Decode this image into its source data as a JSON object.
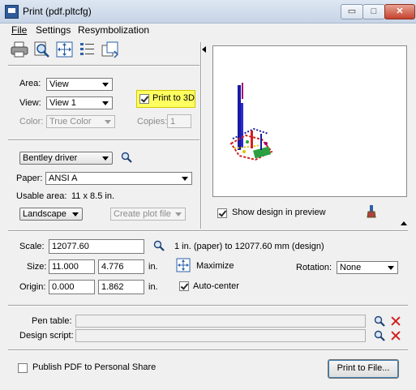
{
  "window": {
    "title": "Print  (pdf.pltcfg)",
    "min_glyph": "▭",
    "max_glyph": "□",
    "close_glyph": "✕"
  },
  "menu": {
    "file": "File",
    "settings": "Settings",
    "resymbolization": "Resymbolization"
  },
  "toolbar": [
    "printer-icon",
    "preview-zoom-icon",
    "fit-icon",
    "list-icon",
    "copy-icon"
  ],
  "area": {
    "label": "Area:",
    "value": "View"
  },
  "view": {
    "label": "View:",
    "value": "View 1"
  },
  "print_to_3d": {
    "label": "Print to 3D",
    "checked": true
  },
  "color": {
    "label": "Color:",
    "value": "True Color"
  },
  "copies": {
    "label": "Copies:",
    "value": "1"
  },
  "driver": {
    "value": "Bentley driver"
  },
  "paper": {
    "label": "Paper:",
    "value": "ANSI A"
  },
  "usable_area": {
    "label": "Usable area:",
    "value": "11 x 8.5 in."
  },
  "orientation": {
    "value": "Landscape"
  },
  "create_plot_file": {
    "value": "Create plot file"
  },
  "show_design": {
    "label": "Show design in preview",
    "checked": true
  },
  "scale": {
    "label": "Scale:",
    "value": "12077.60",
    "description": "1 in. (paper) to 12077.60 mm (design)"
  },
  "size": {
    "label": "Size:",
    "width": "11.000",
    "height": "4.776",
    "unit": "in."
  },
  "maximize": {
    "label": "Maximize"
  },
  "rotation": {
    "label": "Rotation:",
    "value": "None"
  },
  "origin": {
    "label": "Origin:",
    "x": "0.000",
    "y": "1.862",
    "unit": "in."
  },
  "auto_center": {
    "label": "Auto-center",
    "checked": true
  },
  "pen_table": {
    "label": "Pen table:",
    "value": ""
  },
  "design_script": {
    "label": "Design script:",
    "value": ""
  },
  "publish_pdf": {
    "label": "Publish PDF to Personal Share",
    "checked": false
  },
  "print_to_file": {
    "label": "Print to File..."
  },
  "colors": {
    "highlight": "#ffff60",
    "remove_x": "#d02020",
    "accent_blue": "#2f5b9a"
  }
}
